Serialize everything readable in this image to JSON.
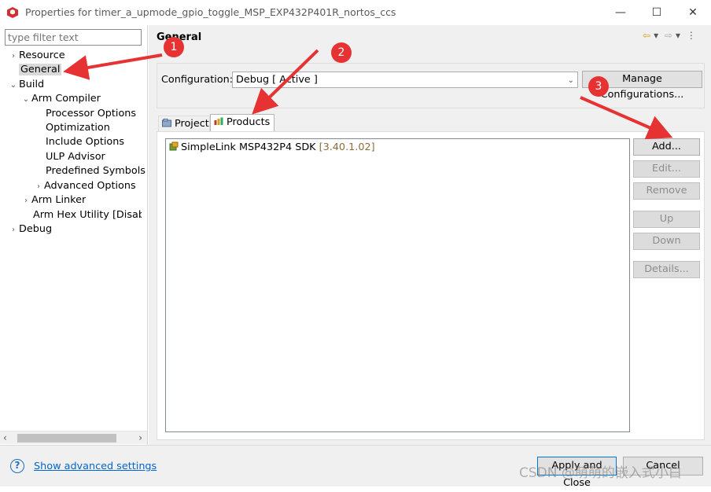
{
  "window": {
    "title": "Properties for timer_a_upmode_gpio_toggle_MSP_EXP432P401R_nortos_ccs",
    "minimize_glyph": "—",
    "maximize_glyph": "☐",
    "close_glyph": "✕"
  },
  "filter": {
    "placeholder": "type filter text"
  },
  "tree": {
    "items": [
      {
        "label": "Resource",
        "twisty": "›"
      },
      {
        "label": "General",
        "twisty": ""
      },
      {
        "label": "Build",
        "twisty": "⌄"
      },
      {
        "label": "Arm Compiler",
        "twisty": "⌄"
      },
      {
        "label": "Processor Options",
        "twisty": ""
      },
      {
        "label": "Optimization",
        "twisty": ""
      },
      {
        "label": "Include Options",
        "twisty": ""
      },
      {
        "label": "ULP Advisor",
        "twisty": ""
      },
      {
        "label": "Predefined Symbols",
        "twisty": ""
      },
      {
        "label": "Advanced Options",
        "twisty": "›"
      },
      {
        "label": "Arm Linker",
        "twisty": "›"
      },
      {
        "label": "Arm Hex Utility  [Disabled]",
        "twisty": ""
      },
      {
        "label": "Debug",
        "twisty": "›"
      }
    ],
    "scroll_left": "‹",
    "scroll_right": "›"
  },
  "page": {
    "title": "General",
    "nav_back": "⇦",
    "nav_menu": "▾",
    "nav_forward": "⇨",
    "nav_more": "⋮"
  },
  "configuration": {
    "label": "Configuration:",
    "value": "Debug  [ Active ]",
    "manage_label": "Manage Configurations..."
  },
  "tabs": [
    {
      "label": "Project",
      "active": false
    },
    {
      "label": "Products",
      "active": true
    }
  ],
  "products": [
    {
      "name": "SimpleLink MSP432P4 SDK",
      "version": "[3.40.1.02]"
    }
  ],
  "buttons": {
    "add": "Add...",
    "edit": "Edit...",
    "remove": "Remove",
    "up": "Up",
    "down": "Down",
    "details": "Details..."
  },
  "footer": {
    "help_glyph": "?",
    "advanced_link": "Show advanced settings",
    "apply_close": "Apply and Close",
    "cancel": "Cancel"
  },
  "annotations": {
    "badges": [
      "1",
      "2",
      "3"
    ],
    "color": "#e63232"
  },
  "watermark": "CSDN @萌萌的嵌入式小白"
}
